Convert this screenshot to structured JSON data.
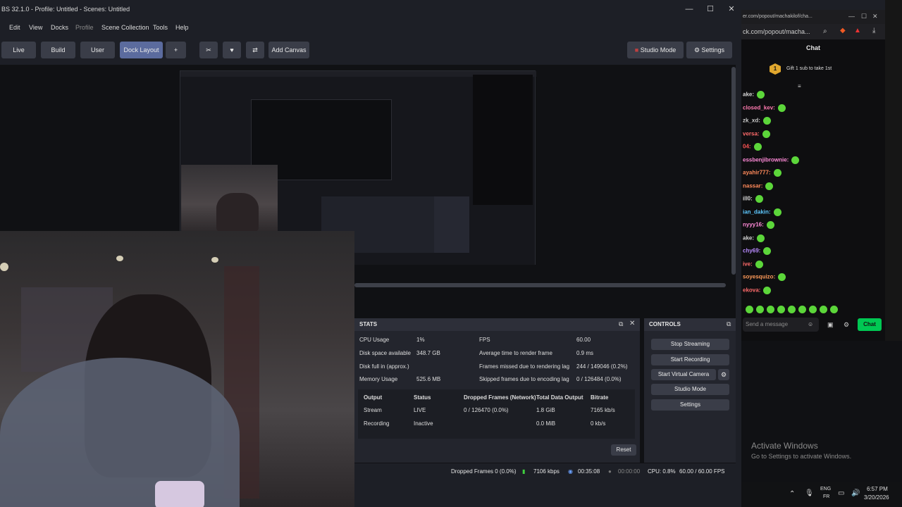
{
  "window": {
    "title": "BS 32.1.0 - Profile: Untitled - Scenes: Untitled"
  },
  "menu": [
    "Edit",
    "View",
    "Docks",
    "Profile",
    "Scene Collection",
    "Tools",
    "Help"
  ],
  "toolbar": {
    "live": "Live",
    "build": "Build",
    "user": "User",
    "dock_layout": "Dock Layout",
    "plus": "+",
    "add_canvas": "Add Canvas",
    "studio_mode": "Studio Mode",
    "settings": "Settings"
  },
  "stats": {
    "title": "STATS",
    "cpu_label": "CPU Usage",
    "cpu_value": "1%",
    "disk_label": "Disk space available",
    "disk_value": "348.7 GB",
    "diskfull_label": "Disk full in (approx.)",
    "diskfull_value": "",
    "mem_label": "Memory Usage",
    "mem_value": "525.6 MB",
    "fps_label": "FPS",
    "fps_value": "60.00",
    "render_label": "Average time to render frame",
    "render_value": "0.9 ms",
    "missed_label": "Frames missed due to rendering lag",
    "missed_value": "244 / 149046 (0.2%)",
    "skipped_label": "Skipped frames due to encoding lag",
    "skipped_value": "0 / 126484 (0.0%)",
    "table_headers": [
      "Output",
      "Status",
      "Dropped Frames (Network)",
      "Total Data Output",
      "Bitrate"
    ],
    "rows": [
      [
        "Stream",
        "LIVE",
        "0 / 126470 (0.0%)",
        "1.8 GiB",
        "7165 kb/s"
      ],
      [
        "Recording",
        "Inactive",
        "",
        "0.0 MiB",
        "0 kb/s"
      ]
    ],
    "reset": "Reset"
  },
  "controls": {
    "title": "CONTROLS",
    "stop_streaming": "Stop Streaming",
    "start_recording": "Start Recording",
    "start_virtual_camera": "Start Virtual Camera",
    "studio_mode": "Studio Mode",
    "settings": "Settings"
  },
  "statusbar": {
    "dropped": "Dropped Frames 0 (0.0%)",
    "kbps": "7106 kbps",
    "live_time": "00:35:08",
    "rec_time": "00:00:00",
    "cpu": "CPU: 0.8%",
    "fps": "60.00 / 60.00 FPS"
  },
  "chat": {
    "window_title": "er.com/popout/machakilof/cha...",
    "url": "ck.com/popout/macha...",
    "header": "Chat",
    "gift_count": "1",
    "gift_text": "Gift 1 sub to take 1st",
    "messages": [
      {
        "user": "ake:",
        "color": "#d8d8d8"
      },
      {
        "user": "closed_kev:",
        "color": "#ff7ab0"
      },
      {
        "user": "zk_xd:",
        "color": "#c9c9c9"
      },
      {
        "user": "versa:",
        "color": "#ff6b6b"
      },
      {
        "user": "04:",
        "color": "#ff5555"
      },
      {
        "user": "essbenjibrownie:",
        "color": "#ff8ad8"
      },
      {
        "user": "ayahir777:",
        "color": "#ff8a5b"
      },
      {
        "user": "nassar:",
        "color": "#ff8a5b"
      },
      {
        "user": "ill0:",
        "color": "#d8d8d8"
      },
      {
        "user": "ian_dakin:",
        "color": "#5ec8ff"
      },
      {
        "user": "nyyy16:",
        "color": "#ff8ad8"
      },
      {
        "user": "ake:",
        "color": "#d8d8d8"
      },
      {
        "user": "chy69:",
        "color": "#b98bff"
      },
      {
        "user": "ive:",
        "color": "#ff6b6b"
      },
      {
        "user": "soyesquizo:",
        "color": "#ff9b5a"
      },
      {
        "user": "ekova:",
        "color": "#ff6b6b"
      }
    ],
    "placeholder": "Send a message",
    "chat_button": "Chat"
  },
  "desktop": {
    "activate_title": "Activate Windows",
    "activate_sub": "Go to Settings to activate Windows."
  },
  "taskbar": {
    "lang1": "ENG",
    "lang2": "FR",
    "time": "6:57 PM",
    "date": "3/20/2026"
  },
  "colors": {
    "accent": "#5b6b9e",
    "twitch_green": "#00c853",
    "emote": "#5cd63a"
  }
}
